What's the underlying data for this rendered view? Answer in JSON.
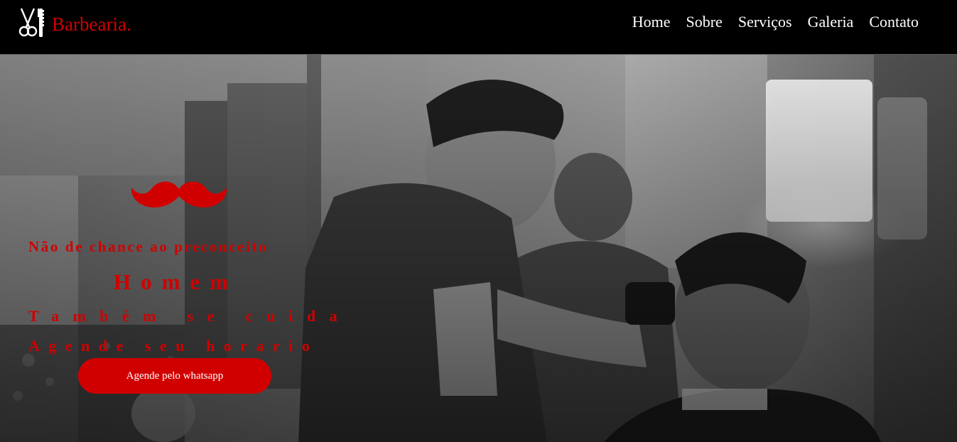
{
  "brand": {
    "name": "Barbearia.",
    "icon": "scissors-comb-icon"
  },
  "nav": {
    "items": [
      {
        "label": "Home"
      },
      {
        "label": "Sobre"
      },
      {
        "label": "Serviços"
      },
      {
        "label": "Galeria"
      },
      {
        "label": "Contato"
      }
    ]
  },
  "hero": {
    "decoration_icon": "mustache-icon",
    "line1": "Não de chance ao preconceito",
    "line2": "Homem",
    "line3": "Também se cuida",
    "line4": "Agende seu horario",
    "cta_label": "Agende pelo whatsapp"
  },
  "colors": {
    "accent": "#d10000",
    "header_bg": "#000000",
    "nav_text": "#ffffff"
  }
}
